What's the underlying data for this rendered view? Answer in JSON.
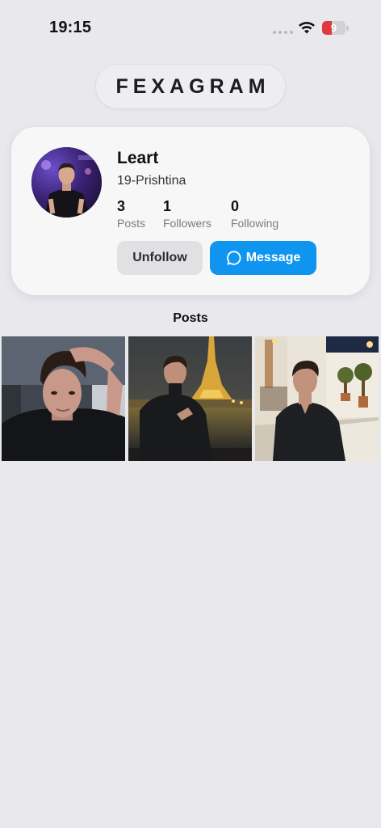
{
  "status_bar": {
    "time": "19:15",
    "battery_level": "9",
    "battery_fraction": 0.09,
    "battery_color": "#e0393b"
  },
  "brand": {
    "title": "FEXAGRAM"
  },
  "profile": {
    "username": "Leart",
    "bio": "19-Prishtina",
    "stats": [
      {
        "count": "3",
        "label": "Posts"
      },
      {
        "count": "1",
        "label": "Followers"
      },
      {
        "count": "0",
        "label": "Following"
      }
    ],
    "unfollow_label": "Unfollow",
    "message_label": "Message",
    "message_icon": "chat-bubble-icon",
    "accent_color": "#0f95f0"
  },
  "posts": {
    "heading": "Posts",
    "items": [
      {
        "name": "post-selfie-hand-in-hair"
      },
      {
        "name": "post-eiffel-tower-night"
      },
      {
        "name": "post-greek-alley-evening"
      }
    ]
  }
}
